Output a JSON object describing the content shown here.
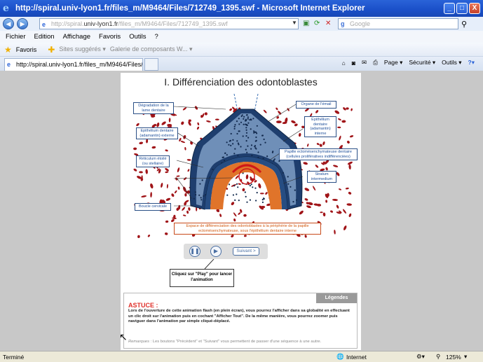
{
  "window": {
    "title": "http://spiral.univ-lyon1.fr/files_m/M9464/Files/712749_1395.swf - Microsoft Internet Explorer",
    "min_label": "_",
    "max_label": "□",
    "close_label": "X"
  },
  "address": {
    "prefix": "http://spiral.",
    "host": "univ-lyon1.fr",
    "suffix": "/files_m/M9464/Files/712749_1395.swf",
    "search_placeholder": "Google",
    "search_logo": "g"
  },
  "menu": [
    "Fichier",
    "Edition",
    "Affichage",
    "Favoris",
    "Outils",
    "?"
  ],
  "favbar": {
    "favoris": "Favoris",
    "suggested": "Sites suggérés ▾",
    "gallery": "Galerie de composants W... ▾"
  },
  "tab": {
    "label": "http://spiral.univ-lyon1.fr/files_m/M9464/Files/71274..."
  },
  "commandbar": {
    "page": "Page ▾",
    "securite": "Sécurité ▾",
    "outils": "Outils ▾"
  },
  "slide": {
    "heading": "I. Différenciation des odontoblastes",
    "labels": {
      "degradation": "Dégradation de la lame dentaire",
      "epith_ext": "Epithélium dentaire (adamantin) externe",
      "reticulum": "Réticulum étoilé (ou stellaire)",
      "boucle": "Boucle cervicale",
      "organe": "Organe de l'émail",
      "epith_int": "Epithélium dentaire (adamantin) interne",
      "papille": "Papille ectomésenchymateuse dentaire (cellules prolifératives indifférenciées)",
      "stratum": "Stratum intermedium",
      "espace": "Espace de différenciation des odontoblastes à la périphérie de la papille ectomésenchymateuse, sous l'épithélium dentaire interne"
    },
    "controls": {
      "next": "Suivant >"
    },
    "callout": "Cliquez sur \"Play\" pour lancer l'animation",
    "astuce": {
      "tab": "Légendes",
      "title": "ASTUCE :",
      "text": "Lors de l'ouverture de cette animation flash (en plein écran), vous pourrez l'afficher dans sa globalité en effectuant un clic droit sur l'animation puis en cochant \"Afficher Tout\". De la même manière, vous pourrez zoomer puis naviguer dans l'animation par simple cliqué-déplacé.",
      "remark_label": "Remarques",
      "remark_text": " : Les boutons \"Précédent\" et \"Suivant\" vous permettent de passer d'une séquence à une autre."
    }
  },
  "status": {
    "left": "Terminé",
    "zone": "Internet",
    "zoom": "125%"
  },
  "colors": {
    "titlebar": "#1a4fc8",
    "label_text": "#1e4f9a",
    "enamel_blue": "#2a4f86",
    "cells_red": "#a01418",
    "orange": "#e0742a",
    "astuce_red": "#e0302a"
  }
}
